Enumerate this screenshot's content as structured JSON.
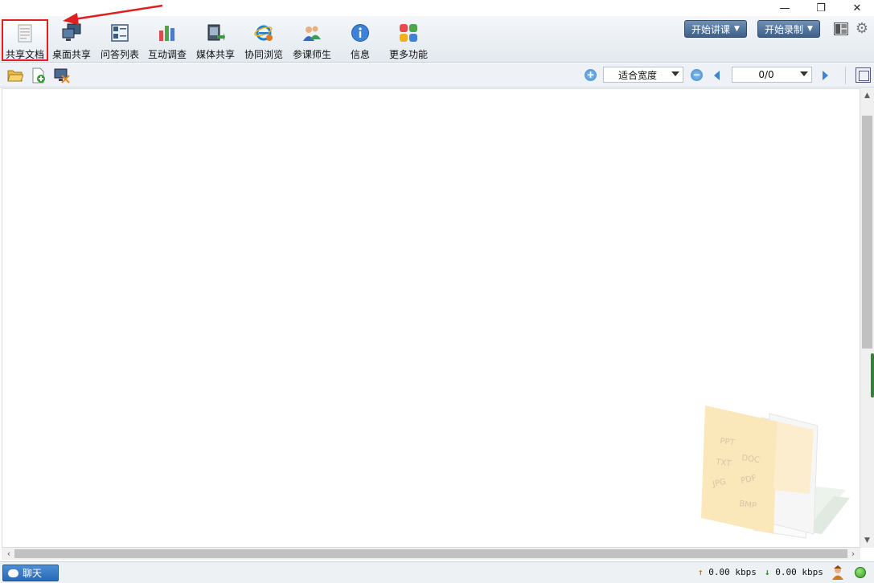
{
  "window": {
    "minimize_glyph": "—",
    "maximize_glyph": "❐",
    "close_glyph": "✕"
  },
  "toolbar": {
    "items": [
      {
        "label": "共享文档",
        "icon": "shared-document-icon",
        "selected": true
      },
      {
        "label": "桌面共享",
        "icon": "desktop-share-icon"
      },
      {
        "label": "问答列表",
        "icon": "qa-list-icon"
      },
      {
        "label": "互动调查",
        "icon": "survey-chart-icon"
      },
      {
        "label": "媒体共享",
        "icon": "media-share-icon"
      },
      {
        "label": "协同浏览",
        "icon": "cobrowse-ie-icon"
      },
      {
        "label": "参课师生",
        "icon": "participants-icon"
      },
      {
        "label": "信息",
        "icon": "info-icon"
      },
      {
        "label": "更多功能",
        "icon": "more-features-icon"
      }
    ],
    "start_lecture_label": "开始讲课",
    "start_record_label": "开始录制"
  },
  "subbar": {
    "zoom_in_glyph": "+",
    "zoom_out_glyph": "−",
    "zoom_mode": "适合宽度",
    "page_indicator": "0/0"
  },
  "statusbar": {
    "chat_label": "聊天",
    "upload_rate": "0.00 kbps",
    "download_rate": "0.00 kbps",
    "up_arrow": "↑",
    "down_arrow": "↓"
  },
  "watermark": {
    "formats": [
      "PPT",
      "DOC",
      "TXT",
      "PDF",
      "JPG",
      "BMP"
    ]
  },
  "colors": {
    "selection_outline": "#e02020",
    "annotation_arrow": "#e02020",
    "accent_blue": "#3a86d3",
    "status_green": "#2f9a1e"
  }
}
